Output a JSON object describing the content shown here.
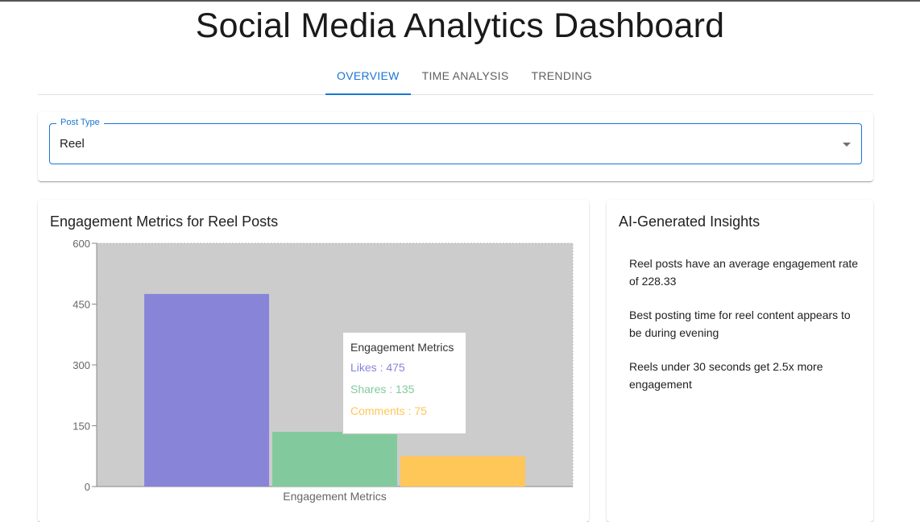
{
  "page": {
    "title": "Social Media Analytics Dashboard"
  },
  "tabs": [
    {
      "label": "OVERVIEW",
      "active": true
    },
    {
      "label": "TIME ANALYSIS",
      "active": false
    },
    {
      "label": "TRENDING",
      "active": false
    }
  ],
  "filter": {
    "label": "Post Type",
    "value": "Reel"
  },
  "chart_card": {
    "title": "Engagement Metrics for Reel Posts"
  },
  "chart_data": {
    "type": "bar",
    "categories": [
      "Engagement Metrics"
    ],
    "series": [
      {
        "name": "Likes",
        "values": [
          475
        ],
        "color": "#8884d8"
      },
      {
        "name": "Shares",
        "values": [
          135
        ],
        "color": "#82ca9d"
      },
      {
        "name": "Comments",
        "values": [
          75
        ],
        "color": "#ffc658"
      }
    ],
    "ylim": [
      0,
      600
    ],
    "yticks": [
      0,
      150,
      300,
      450,
      600
    ],
    "xlabel": "Engagement Metrics",
    "plot_background": "#cccccc",
    "tooltip": {
      "title": "Engagement Metrics",
      "rows": [
        {
          "name": "Likes",
          "value": 475,
          "text": "Likes : 475",
          "color": "#8884d8"
        },
        {
          "name": "Shares",
          "value": 135,
          "text": "Shares : 135",
          "color": "#82ca9d"
        },
        {
          "name": "Comments",
          "value": 75,
          "text": "Comments : 75",
          "color": "#ffc658"
        }
      ]
    }
  },
  "insights_card": {
    "title": "AI-Generated Insights",
    "items": [
      "Reel posts have an average engagement rate of 228.33",
      "Best posting time for reel content appears to be during evening",
      "Reels under 30 seconds get 2.5x more engagement"
    ]
  },
  "colors": {
    "accent": "#1976d2"
  }
}
